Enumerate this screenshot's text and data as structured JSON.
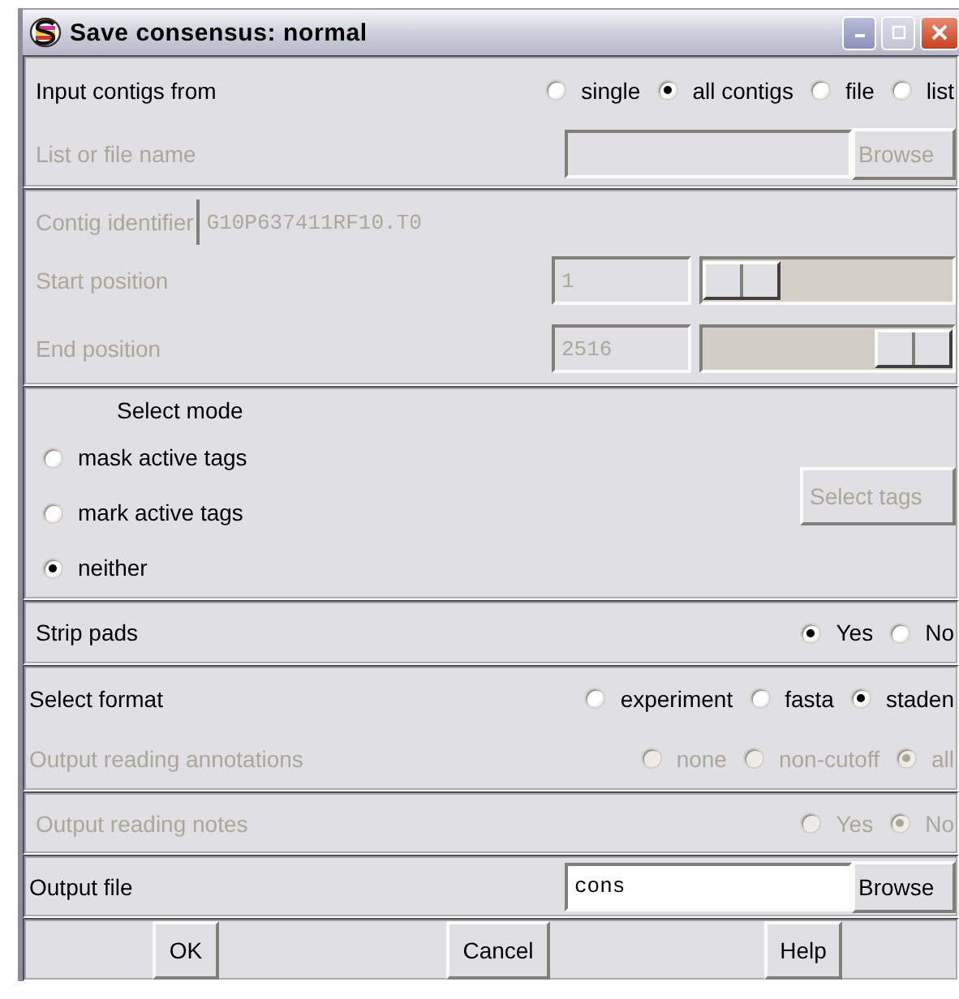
{
  "window": {
    "title": "Save consensus: normal"
  },
  "input_contigs": {
    "label": "Input contigs from",
    "options": [
      {
        "label": "single",
        "selected": false
      },
      {
        "label": "all contigs",
        "selected": true
      },
      {
        "label": "file",
        "selected": false
      },
      {
        "label": "list",
        "selected": false
      }
    ]
  },
  "list_file": {
    "label": "List or file name",
    "disabled": true,
    "button": "Browse"
  },
  "contig": {
    "label": "Contig identifier",
    "value": "G10P637411RF10.T0",
    "disabled": true
  },
  "positions": [
    {
      "label": "Start position",
      "value": "1",
      "level": 0,
      "disabled": true
    },
    {
      "label": "End position",
      "value": "2516",
      "level": 1,
      "disabled": true
    }
  ],
  "select_mode": {
    "title": "Select mode",
    "options": [
      {
        "label": "mask active tags",
        "selected": false
      },
      {
        "label": "mark active tags",
        "selected": false
      },
      {
        "label": "neither",
        "selected": true
      }
    ],
    "button": "Select tags",
    "button_disabled": true
  },
  "strip_pads": {
    "label": "Strip pads",
    "disabled": false,
    "options": [
      {
        "label": "Yes",
        "selected": true
      },
      {
        "label": "No",
        "selected": false
      }
    ]
  },
  "select_format": {
    "label": "Select format",
    "disabled": false,
    "options": [
      {
        "label": "experiment",
        "selected": false
      },
      {
        "label": "fasta",
        "selected": false
      },
      {
        "label": "staden",
        "selected": true
      }
    ]
  },
  "annotations": {
    "label": "Output reading annotations",
    "disabled": true,
    "options": [
      {
        "label": "none",
        "selected": false
      },
      {
        "label": "non-cutoff",
        "selected": false
      },
      {
        "label": "all",
        "selected": true
      }
    ]
  },
  "notes": {
    "label": "Output reading notes",
    "disabled": true,
    "options": [
      {
        "label": "Yes",
        "selected": false
      },
      {
        "label": "No",
        "selected": true
      }
    ]
  },
  "output_file": {
    "label": "Output file",
    "value": "cons",
    "button": "Browse"
  },
  "buttons": [
    "OK",
    "Cancel",
    "Help"
  ]
}
